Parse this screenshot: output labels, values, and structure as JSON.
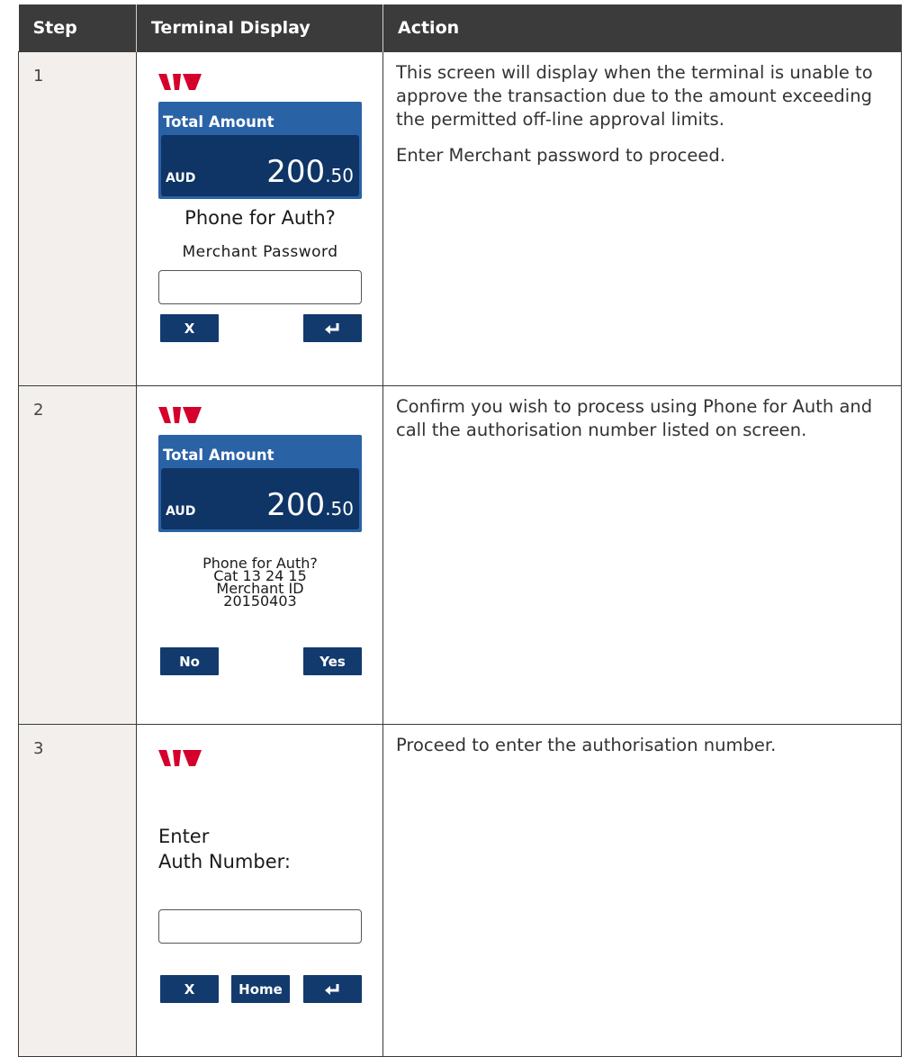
{
  "table": {
    "headers": [
      "Step",
      "Terminal Display",
      "Action"
    ]
  },
  "brand": {
    "logo_color": "#d5002b",
    "amount_box_color": "#2a62a6",
    "amount_inner_color": "#0f3466",
    "button_color": "#123a6d"
  },
  "rows": [
    {
      "step": "1",
      "terminal": {
        "total_label": "Total Amount",
        "currency": "AUD",
        "amount_main": "200",
        "amount_cents": ".50",
        "prompt": "Phone for Auth?",
        "field_label": "Merchant Password",
        "btn_cancel": "X",
        "btn_enter_icon": "enter-arrow-icon"
      },
      "action": [
        "This screen will display when the terminal is unable to approve the transaction due to the amount exceeding the permitted off-line approval limits.",
        "Enter Merchant password to proceed."
      ]
    },
    {
      "step": "2",
      "terminal": {
        "total_label": "Total Amount",
        "currency": "AUD",
        "amount_main": "200",
        "amount_cents": ".50",
        "info_lines": [
          "Phone for Auth?",
          "Cat 13 24 15",
          "Merchant ID",
          "20150403"
        ],
        "btn_no": "No",
        "btn_yes": "Yes"
      },
      "action": [
        "Confirm you wish to process using Phone for Auth and call the authorisation number listed on screen."
      ]
    },
    {
      "step": "3",
      "terminal": {
        "prompt_lines": [
          "Enter",
          "Auth Number:"
        ],
        "btn_cancel": "X",
        "btn_home": "Home",
        "btn_enter_icon": "enter-arrow-icon"
      },
      "action": [
        "Proceed to enter the authorisation number."
      ]
    }
  ]
}
